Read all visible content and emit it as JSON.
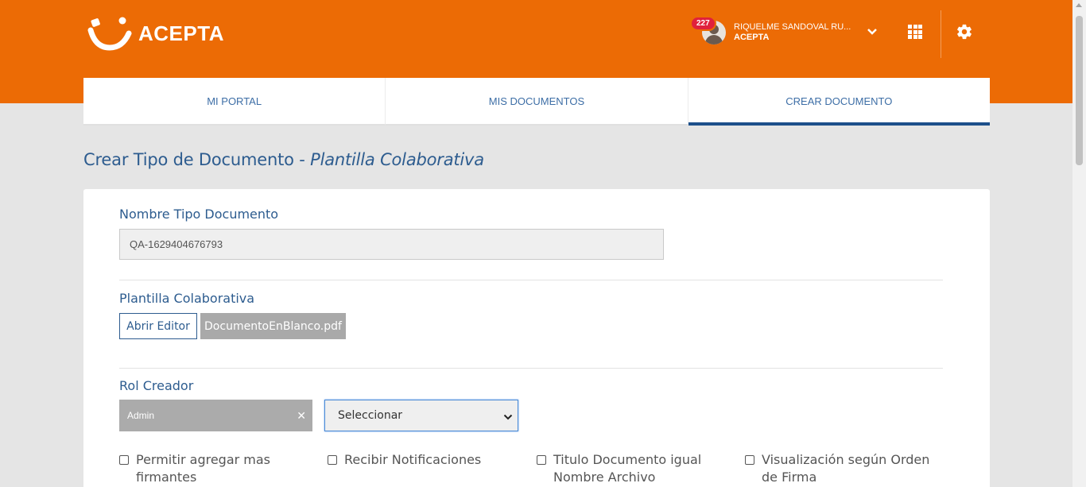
{
  "header": {
    "logo_text": "ACEPTA",
    "notification_count": "227",
    "user_name": "RIQUELME SANDOVAL RU...",
    "user_org": "ACEPTA",
    "brand_color": "#ec6b05"
  },
  "tabs": [
    {
      "label": "MI PORTAL",
      "active": false
    },
    {
      "label": "MIS DOCUMENTOS",
      "active": false
    },
    {
      "label": "CREAR DOCUMENTO",
      "active": true
    }
  ],
  "page": {
    "title_main": "Crear Tipo de Documento - ",
    "title_italic": "Plantilla Colaborativa"
  },
  "form": {
    "doc_type_label": "Nombre Tipo Documento",
    "doc_type_value": "QA-1629404676793",
    "template_label": "Plantilla Colaborativa",
    "open_editor_label": "Abrir Editor",
    "file_name": "DocumentoEnBlanco.pdf",
    "creator_role_label": "Rol Creador",
    "selected_role_tag": "Admin",
    "role_select_value": "Seleccionar",
    "checkboxes": [
      {
        "label": "Permitir agregar mas firmantes",
        "checked": false
      },
      {
        "label": "Recibir Notificaciones",
        "checked": false
      },
      {
        "label": "Titulo Documento igual Nombre Archivo",
        "checked": false
      },
      {
        "label": "Visualización según Orden de Firma",
        "checked": false
      }
    ]
  }
}
